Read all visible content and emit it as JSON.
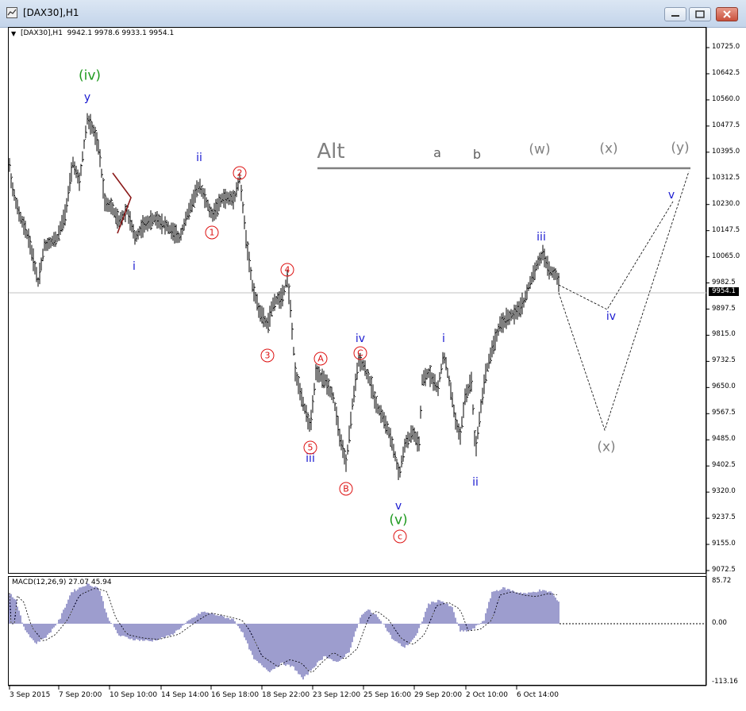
{
  "window": {
    "title": "[DAX30],H1",
    "buttons": [
      "minimize-icon",
      "restore-icon",
      "close-icon"
    ]
  },
  "chart_info": {
    "collapse_arrow": "▼",
    "ohlc_text": "[DAX30],H1  9942.1 9978.6 9933.1 9954.1"
  },
  "price_axis": {
    "labels": [
      "10725.0",
      "10642.5",
      "10560.0",
      "10477.5",
      "10395.0",
      "10312.5",
      "10230.0",
      "10147.5",
      "10065.0",
      "9982.5",
      "9897.5",
      "9815.0",
      "9732.5",
      "9650.0",
      "9567.5",
      "9485.0",
      "9402.5",
      "9320.0",
      "9237.5",
      "9155.0",
      "9072.5"
    ],
    "current_price": "9954.1"
  },
  "macd": {
    "label": "MACD(12,26,9) 27.07 45.94",
    "axis_labels": [
      "85.72",
      "0.00",
      "-113.16"
    ]
  },
  "time_axis": {
    "labels": [
      "3 Sep 2015",
      "7 Sep 20:00",
      "10 Sep 10:00",
      "14 Sep 14:00",
      "16 Sep 18:00",
      "18 Sep 22:00",
      "23 Sep 12:00",
      "25 Sep 16:00",
      "29 Sep 20:00",
      "2 Oct 10:00",
      "6 Oct 14:00"
    ]
  },
  "wave_labels": {
    "green_iv": "(iv)",
    "green_v": "(v)",
    "blue_y": "y",
    "blue_ii_top": "ii",
    "blue_i_low": "i",
    "blue_iii_low": "iii",
    "blue_iv_mid": "iv",
    "blue_v_low": "v",
    "blue_i_oct": "i",
    "blue_ii_oct": "ii",
    "blue_iii_oct": "iii",
    "blue_iv_proj": "iv",
    "blue_v_proj": "v",
    "red_1": "1",
    "red_2": "2",
    "red_3": "3",
    "red_4": "4",
    "red_5": "5",
    "red_A": "A",
    "red_B": "B",
    "red_C": "C",
    "red_c": "c"
  },
  "alt_scenario": {
    "title": "Alt",
    "labels": [
      "a",
      "b",
      "(w)",
      "(x)",
      "(y)"
    ],
    "proj_x": "(x)"
  },
  "colors": {
    "green": "#1f9a1f",
    "blue": "#1a1ad0",
    "red": "#d11111",
    "gray": "#808080",
    "macd_bars": "#3b3b9e"
  }
}
